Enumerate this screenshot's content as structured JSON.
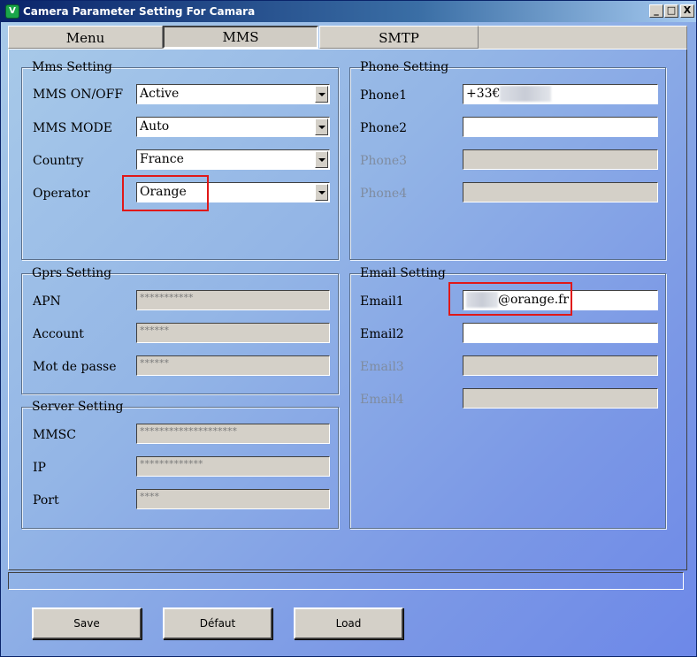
{
  "window": {
    "title": "Camera Parameter Setting For  Camara",
    "app_icon": "V",
    "caption_buttons": {
      "minimize": "_",
      "maximize": "□",
      "close": "X"
    }
  },
  "tabs": [
    {
      "label": "Menu",
      "active": false
    },
    {
      "label": "MMS",
      "active": true
    },
    {
      "label": "SMTP",
      "active": false
    }
  ],
  "mms_setting": {
    "title": "Mms Setting",
    "fields": [
      {
        "label": "MMS ON/OFF",
        "value": "Active"
      },
      {
        "label": "MMS MODE",
        "value": "Auto"
      },
      {
        "label": "Country",
        "value": "France"
      },
      {
        "label": "Operator",
        "value": "Orange"
      }
    ]
  },
  "phone_setting": {
    "title": "Phone Setting",
    "fields": [
      {
        "label": "Phone1",
        "value": "+33€"
      },
      {
        "label": "Phone2",
        "value": ""
      },
      {
        "label": "Phone3",
        "value": ""
      },
      {
        "label": "Phone4",
        "value": ""
      }
    ]
  },
  "gprs_setting": {
    "title": "Gprs Setting",
    "fields": [
      {
        "label": "APN",
        "value": "***********"
      },
      {
        "label": "Account",
        "value": "******"
      },
      {
        "label": "Mot de passe",
        "value": "******"
      }
    ]
  },
  "email_setting": {
    "title": "Email Setting",
    "fields": [
      {
        "label": "Email1",
        "value": "@orange.fr"
      },
      {
        "label": "Email2",
        "value": ""
      },
      {
        "label": "Email3",
        "value": ""
      },
      {
        "label": "Email4",
        "value": ""
      }
    ]
  },
  "server_setting": {
    "title": "Server Setting",
    "fields": [
      {
        "label": "MMSC",
        "value": "********************"
      },
      {
        "label": "IP",
        "value": "*************"
      },
      {
        "label": "Port",
        "value": "****"
      }
    ]
  },
  "buttons": {
    "save": "Save",
    "default": "Défaut",
    "load": "Load"
  },
  "colors": {
    "highlight": "#e01818",
    "titlebar": "#0a246a",
    "background": "#93b5e6"
  }
}
